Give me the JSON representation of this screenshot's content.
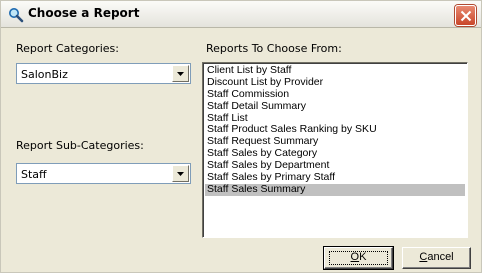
{
  "window": {
    "title": "Choose a Report",
    "icon": "magnifier-icon",
    "close_icon": "close-icon"
  },
  "categories": {
    "label": "Report Categories:",
    "selected": "SalonBiz"
  },
  "subcategories": {
    "label": "Report Sub-Categories:",
    "selected": "Staff"
  },
  "reports": {
    "label": "Reports To Choose From:",
    "items": [
      "Client List by Staff",
      "Discount List by Provider",
      "Staff Commission",
      "Staff Detail Summary",
      "Staff List",
      "Staff Product Sales Ranking by SKU",
      "Staff Request Summary",
      "Staff Sales by Category",
      "Staff Sales by Department",
      "Staff Sales by Primary Staff",
      "Staff Sales Summary"
    ],
    "selected_index": 10
  },
  "buttons": {
    "ok_mnemonic": "O",
    "ok_rest": "K",
    "cancel_mnemonic": "C",
    "cancel_rest": "ancel"
  },
  "colors": {
    "close_button": "#c9462a",
    "selection": "#c0c0c0",
    "dialog_face": "#ece9d8"
  }
}
